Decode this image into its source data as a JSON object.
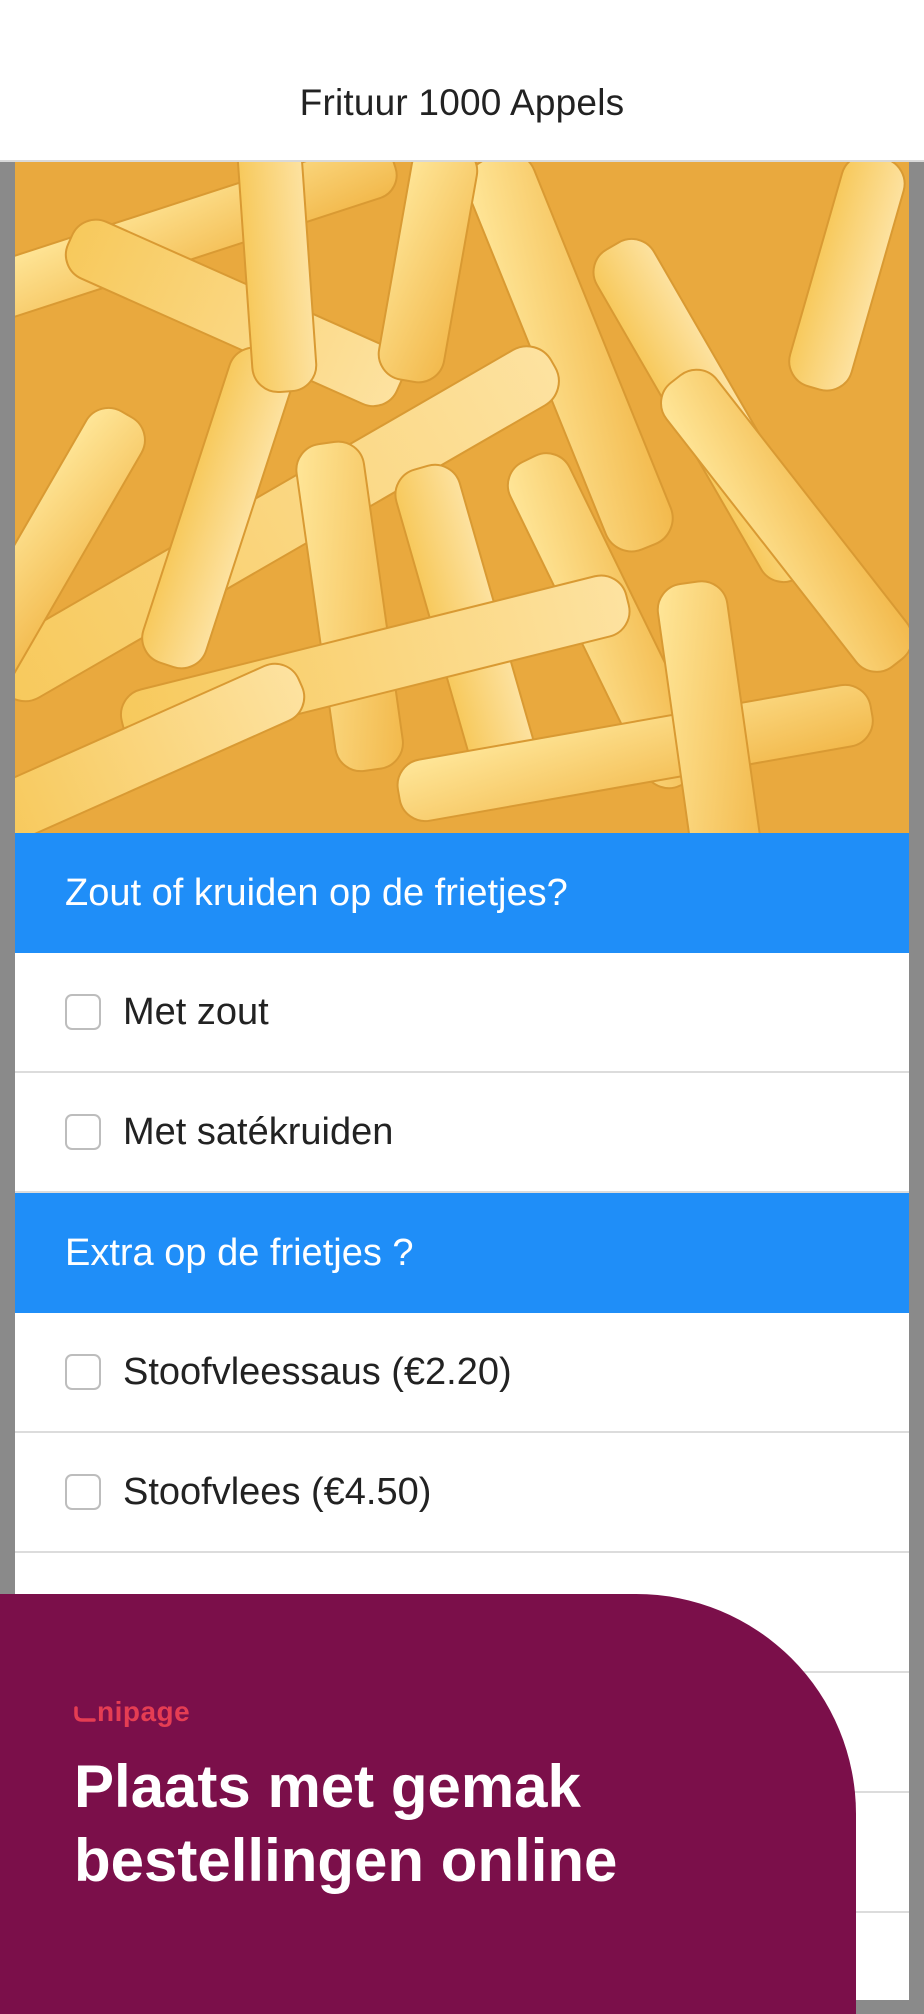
{
  "header": {
    "title": "Frituur 1000 Appels"
  },
  "hero": {
    "image": "french-fries-photo"
  },
  "groups": [
    {
      "title": "Zout of kruiden op de frietjes?",
      "options": [
        {
          "label": "Met zout",
          "checked": false
        },
        {
          "label": "Met satékruiden",
          "checked": false
        }
      ]
    },
    {
      "title": "Extra op de frietjes ?",
      "options": [
        {
          "label": "Stoofvleessaus (€2.20)",
          "checked": false
        },
        {
          "label": "Stoofvlees (€4.50)",
          "checked": false
        },
        {
          "label": "",
          "checked": false
        },
        {
          "label": "",
          "checked": false
        },
        {
          "label": "",
          "checked": false
        }
      ]
    }
  ],
  "promo": {
    "brand": "nipage",
    "headline_line1": "Plaats met gemak",
    "headline_line2": "bestellingen online"
  },
  "colors": {
    "section_header": "#1f8ef8",
    "promo_background": "#7b0f4a",
    "brand_red": "#e53d53"
  }
}
